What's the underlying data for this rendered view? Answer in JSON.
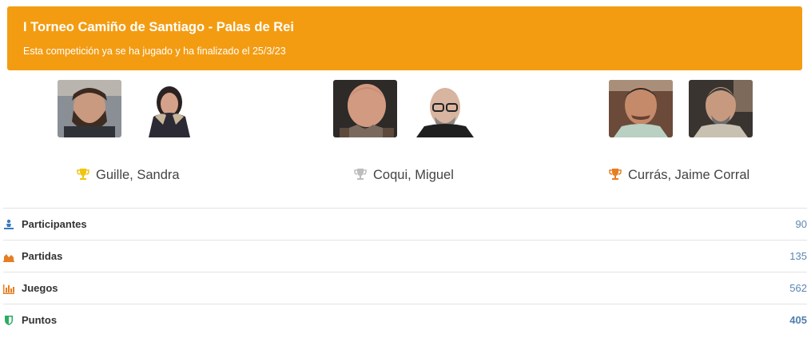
{
  "banner": {
    "title": "I Torneo Camiño de Santiago - Palas de Rei",
    "subtitle": "Esta competición ya se ha jugado y ha finalizado el 25/3/23"
  },
  "podium": [
    {
      "place": "first",
      "trophy_color": "#f1c40f",
      "names": "Guille, Sandra",
      "trophy_icon": "trophy-gold-icon"
    },
    {
      "place": "second",
      "trophy_color": "#bdbdbd",
      "names": "Coqui, Miguel",
      "trophy_icon": "trophy-silver-icon"
    },
    {
      "place": "third",
      "trophy_color": "#e67e22",
      "names": "Currás, Jaime Corral",
      "trophy_icon": "trophy-bronze-icon"
    }
  ],
  "stats": [
    {
      "label": "Participantes",
      "value": "90",
      "icon": "participants-icon",
      "icon_color": "#3b7bbf"
    },
    {
      "label": "Partidas",
      "value": "135",
      "icon": "area-chart-icon",
      "icon_color": "#e67e22"
    },
    {
      "label": "Juegos",
      "value": "562",
      "icon": "bar-chart-icon",
      "icon_color": "#e67e22"
    },
    {
      "label": "Puntos",
      "value": "405",
      "icon": "shield-icon",
      "icon_color": "#27ae60"
    }
  ],
  "colors": {
    "banner": "#f39c12",
    "value_link": "#5b86b3"
  }
}
